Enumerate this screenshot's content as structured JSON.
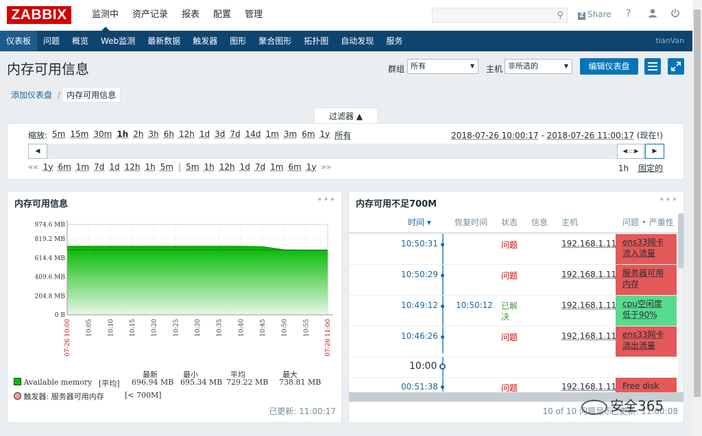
{
  "header": {
    "logo": "ZABBIX",
    "menu": [
      "监测中",
      "资产记录",
      "报表",
      "配置",
      "管理"
    ],
    "share_label": "Share",
    "help_icon": "?",
    "icons": [
      "search-icon",
      "share-icon",
      "help-icon",
      "user-icon",
      "power-icon"
    ]
  },
  "nav": {
    "items": [
      "仪表板",
      "问题",
      "概览",
      "Web监测",
      "最新数据",
      "触发器",
      "图形",
      "聚合图形",
      "拓扑图",
      "自动发现",
      "服务"
    ],
    "user": "tianVan"
  },
  "page": {
    "title": "内存可用信息",
    "group_label": "群组",
    "group_value": "所有",
    "host_label": "主机",
    "host_value": "非所选的",
    "edit_button": "编辑仪表盘"
  },
  "breadcrumb": {
    "parent": "添加仪表盘",
    "current": "内存可用信息"
  },
  "filter": {
    "tab_label": "过滤器",
    "zoom_label": "缩放:",
    "zoom_options": [
      "5m",
      "15m",
      "30m",
      "1h",
      "2h",
      "3h",
      "6h",
      "12h",
      "1d",
      "3d",
      "7d",
      "14d",
      "1m",
      "3m",
      "6m",
      "1y",
      "所有"
    ],
    "zoom_selected": "1h",
    "period_from": "2018-07-26 10:00:17",
    "period_sep": " - ",
    "period_to": "2018-07-26 11:00:17",
    "period_suffix": "(现在!)",
    "nav_back_arrows": "«« ",
    "nav_left": [
      "1y",
      "6m",
      "1m",
      "7d",
      "1d",
      "12h",
      "1h",
      "5m"
    ],
    "nav_divider": "|",
    "nav_right": [
      "5m",
      "1h",
      "12h",
      "1d",
      "7d",
      "1m",
      "6m",
      "1y"
    ],
    "nav_fwd_arrows": "»»",
    "current_span": "1h",
    "fixed_label": "固定的"
  },
  "widget_graph": {
    "title": "内存可用信息",
    "legend_headers": [
      "最新",
      "最小",
      "平均",
      "最大"
    ],
    "series_name": "Available memory",
    "series_func": "[平均]",
    "series_values": [
      "696.94 MB",
      "695.34 MB",
      "729.22 MB",
      "738.81 MB"
    ],
    "trigger_label": "触发器: 服务器可用内存",
    "trigger_cond": "[< 700M]",
    "colors": {
      "series": "#00c000",
      "trigger": "#ff8080"
    },
    "updated": "已更新: 11:00:17"
  },
  "chart_data": {
    "type": "area",
    "x": [
      "07-26 10:00",
      "10:05",
      "10:10",
      "10:15",
      "10:20",
      "10:25",
      "10:30",
      "10:35",
      "10:40",
      "10:45",
      "10:50",
      "10:55",
      "07-26 11:00"
    ],
    "series": [
      {
        "name": "Available memory",
        "values": [
          738,
          738,
          738,
          738,
          738,
          738,
          738,
          738,
          738,
          735,
          700,
          697,
          697
        ]
      }
    ],
    "y_ticks": [
      "974.6 MB",
      "819.2 MB",
      "614.4 MB",
      "409.6 MB",
      "204.8 MB",
      "0 B"
    ],
    "y_values": [
      974.6,
      819.2,
      614.4,
      409.6,
      204.8,
      0
    ],
    "ylim": [
      0,
      974.6
    ],
    "trigger_value": 700,
    "grid": true
  },
  "widget_problems": {
    "title": "内存可用不足700M",
    "headers": [
      "时间 ▾",
      "恢复时间",
      "状态",
      "信息",
      "主机",
      "问题 • 严重性"
    ],
    "rows": [
      {
        "time": "10:50:31",
        "recovery": "",
        "status": "问题",
        "host": "192.168.1.11",
        "problem": "ens33网卡流入流量",
        "severity_color": "#e45959",
        "resolved": false
      },
      {
        "time": "10:50:29",
        "recovery": "",
        "status": "问题",
        "host": "192.168.1.11",
        "problem": "服务器可用内存",
        "severity_color": "#e45959",
        "resolved": false
      },
      {
        "time": "10:49:12",
        "recovery": "10:50:12",
        "status": "已解决",
        "host": "192.168.1.11",
        "problem": "cpu空闲度低于90%",
        "severity_color": "#59db8f",
        "resolved": true
      },
      {
        "time": "10:46:26",
        "recovery": "",
        "status": "问题",
        "host": "192.168.1.11",
        "problem": "ens33网卡流出流量",
        "severity_color": "#e45959",
        "resolved": false
      }
    ],
    "marker": "10:00",
    "last_row": {
      "time": "00:51:38",
      "status": "问题",
      "host": "192.168.1.11",
      "problem": "Free disk"
    },
    "count_text": "10 of 10 问题显示",
    "updated": "已更新: 11:00:08"
  },
  "watermark": "安全365"
}
